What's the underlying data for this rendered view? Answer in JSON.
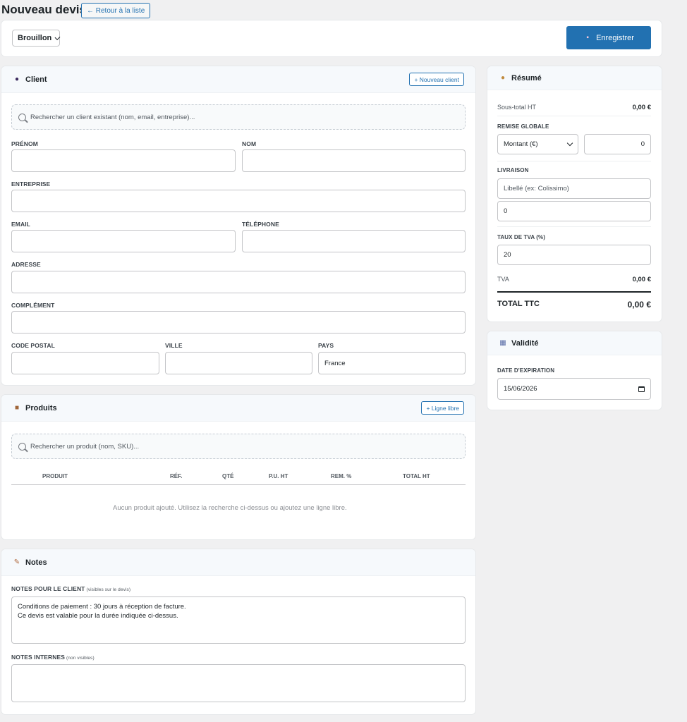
{
  "header": {
    "title": "Nouveau devis",
    "back_label": "← Retour à la liste"
  },
  "topbar": {
    "status": "Brouillon",
    "save_label": "Enregistrer"
  },
  "client": {
    "title": "Client",
    "new_client_label": "+ Nouveau client",
    "search_placeholder": "Rechercher un client existant (nom, email, entreprise)...",
    "labels": {
      "prenom": "PRÉNOM",
      "nom": "NOM",
      "entreprise": "ENTREPRISE",
      "email": "EMAIL",
      "telephone": "TÉLÉPHONE",
      "adresse": "ADRESSE",
      "complement": "COMPLÉMENT",
      "code_postal": "CODE POSTAL",
      "ville": "VILLE",
      "pays": "PAYS"
    },
    "values": {
      "pays": "France"
    }
  },
  "produits": {
    "title": "Produits",
    "add_line_label": "+ Ligne libre",
    "search_placeholder": "Rechercher un produit (nom, SKU)...",
    "columns": [
      "PRODUIT",
      "RÉF.",
      "QTÉ",
      "P.U. HT",
      "REM. %",
      "TOTAL HT"
    ],
    "empty": "Aucun produit ajouté. Utilisez la recherche ci-dessus ou ajoutez une ligne libre."
  },
  "notes": {
    "title": "Notes",
    "client_label": "NOTES POUR LE CLIENT",
    "client_hint": "(visibles sur le devis)",
    "client_value": "Conditions de paiement : 30 jours à réception de facture.\nCe devis est valable pour la durée indiquée ci-dessus.",
    "internal_label": "NOTES INTERNES",
    "internal_hint": "(non visibles)"
  },
  "resume": {
    "title": "Résumé",
    "subtotal_label": "Sous-total HT",
    "subtotal_value": "0,00 €",
    "remise_label": "REMISE GLOBALE",
    "remise_type": "Montant (€)",
    "remise_value": "0",
    "livraison_label": "LIVRAISON",
    "livraison_placeholder": "Libellé (ex: Colissimo)",
    "livraison_value": "0",
    "tva_rate_label": "TAUX DE TVA (%)",
    "tva_rate_value": "20",
    "tva_label": "TVA",
    "tva_value": "0,00 €",
    "total_label": "TOTAL TTC",
    "total_value": "0,00 €"
  },
  "validite": {
    "title": "Validité",
    "expiration_label": "DATE D'EXPIRATION",
    "expiration_value": "15/06/2026"
  }
}
